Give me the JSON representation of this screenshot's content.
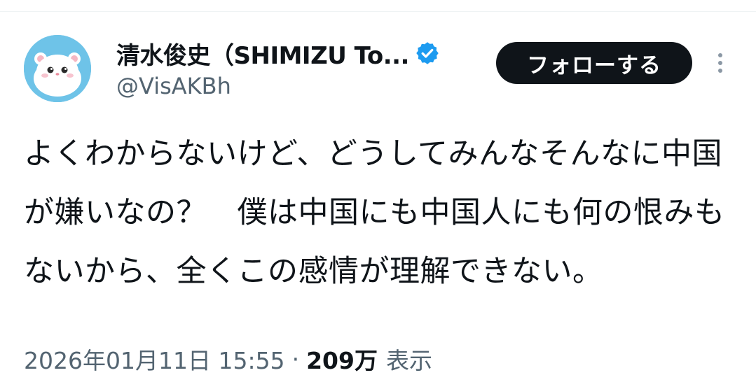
{
  "author": {
    "display_name": "清水俊史（SHIMIZU To...",
    "handle": "@VisAKBh",
    "avatar_icon": "hamster-avatar-icon",
    "verified_icon": "verified-badge-icon",
    "verified_color": "#1d9bf0"
  },
  "actions": {
    "follow_label": "フォローする",
    "more_icon": "more-options-icon"
  },
  "tweet": {
    "text": "よくわからないけど、どうしてみんなそんなに中国が嫌いなの？　僕は中国にも中国人にも何の恨みもないから、全くこの感情が理解できない。"
  },
  "meta": {
    "timestamp": "2026年01月11日 15:55",
    "separator": "·",
    "views_count": "209万",
    "views_label": "表示"
  },
  "colors": {
    "text_primary": "#0f1419",
    "text_secondary": "#536471",
    "button_bg": "#0f1419",
    "divider": "#eff3f4"
  }
}
